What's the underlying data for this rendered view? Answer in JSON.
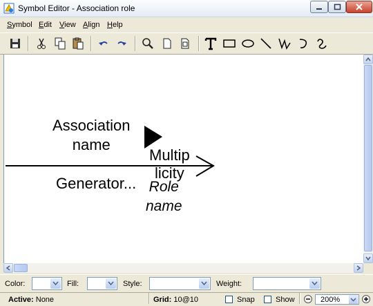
{
  "window": {
    "title": "Symbol Editor - Association role"
  },
  "menu": [
    {
      "label": "Symbol",
      "access_key": "S"
    },
    {
      "label": "Edit",
      "access_key": "E"
    },
    {
      "label": "View",
      "access_key": "V"
    },
    {
      "label": "Align",
      "access_key": "A"
    },
    {
      "label": "Help",
      "access_key": "H"
    }
  ],
  "toolbar": {
    "buttons": [
      "save-icon",
      "cut-icon",
      "copy-icon",
      "paste-icon",
      "undo-icon",
      "redo-icon",
      "zoom-icon",
      "page-icon",
      "page-fit-icon",
      "text-tool-icon",
      "rectangle-tool-icon",
      "ellipse-tool-icon",
      "line-tool-icon",
      "polyline-tool-icon",
      "arc-tool-icon",
      "curve-tool-icon"
    ]
  },
  "canvas": {
    "texts": {
      "association_name_1": "Association",
      "association_name_2": "name",
      "multiplicity_1": "Multip",
      "multiplicity_2": "licity",
      "generator": "Generator...",
      "role_name_1": "Role",
      "role_name_2": "name"
    }
  },
  "properties": {
    "color_label": "Color:",
    "fill_label": "Fill:",
    "style_label": "Style:",
    "weight_label": "Weight:",
    "color_value": "",
    "fill_value": "",
    "style_value": "",
    "weight_value": ""
  },
  "status": {
    "active_label": "Active:",
    "active_value": "None",
    "grid_label": "Grid:",
    "grid_value": "10@10",
    "snap_label": "Snap",
    "snap_checked": false,
    "show_label": "Show",
    "show_checked": false,
    "zoom_value": "200%"
  }
}
